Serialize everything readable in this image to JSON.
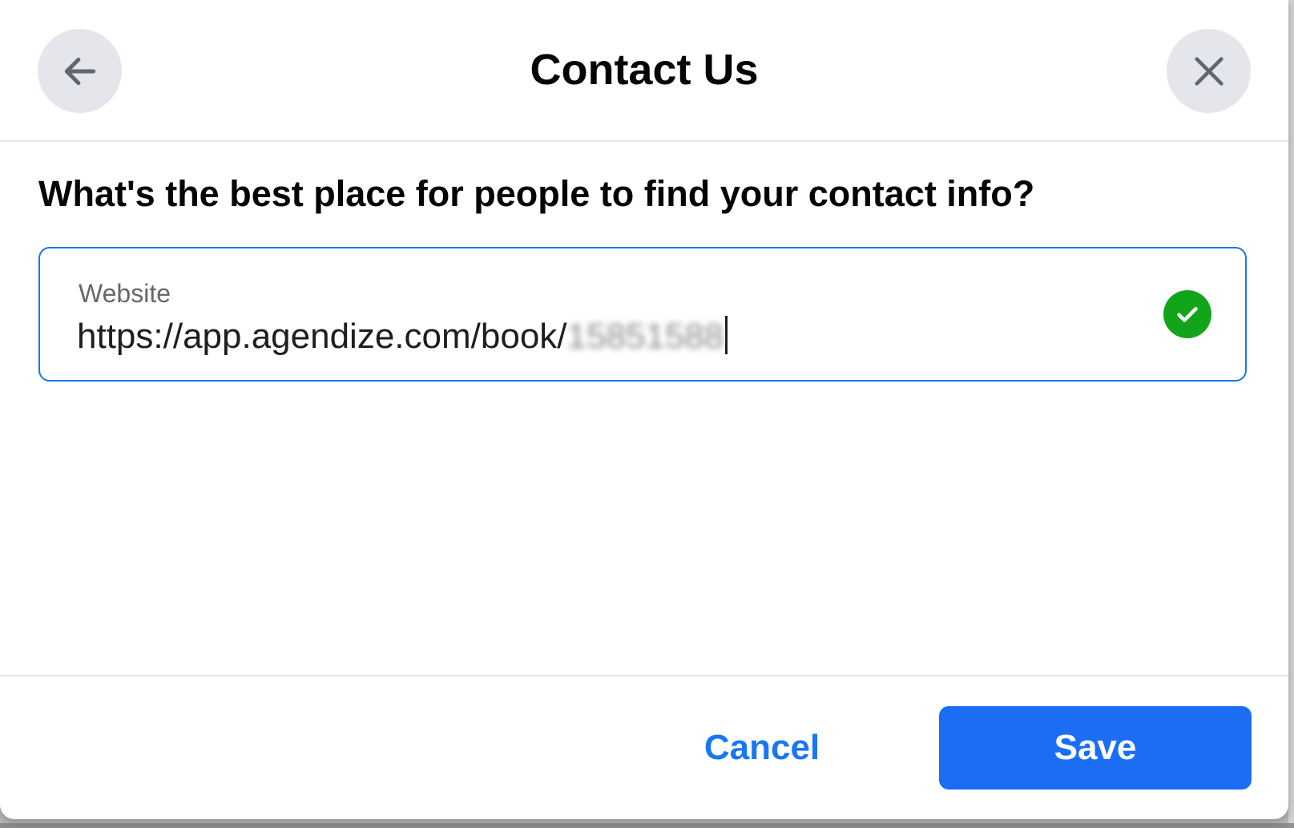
{
  "dialog": {
    "title": "Contact Us",
    "back_icon": "arrow-left-icon",
    "close_icon": "close-icon"
  },
  "form": {
    "question": "What's the best place for people to find your contact info?",
    "website_field": {
      "label": "Website",
      "value_visible": "https://app.agendize.com/book/",
      "value_redacted": "15851588",
      "status_icon": "check-circle-icon",
      "status_color": "#12a51b"
    }
  },
  "footer": {
    "cancel_label": "Cancel",
    "save_label": "Save"
  },
  "colors": {
    "accent": "#1877f2",
    "save_button": "#1b6ef3",
    "icon_button_bg": "#e4e6eb"
  }
}
